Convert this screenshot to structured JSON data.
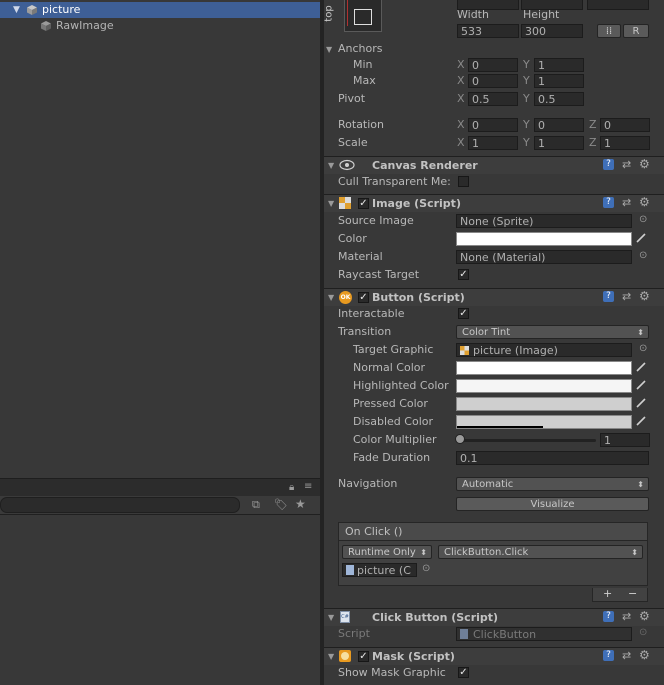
{
  "hierarchy": {
    "items": [
      {
        "label": "picture",
        "selected": true
      },
      {
        "label": "RawImage",
        "selected": false
      }
    ]
  },
  "rect_transform": {
    "anchor_preset_label": "top",
    "width_label": "Width",
    "height_label": "Height",
    "width_value": "533",
    "height_value": "300",
    "r_button": "R",
    "anchors_label": "Anchors",
    "min_label": "Min",
    "max_label": "Max",
    "min_x": "0",
    "min_y": "1",
    "max_x": "0",
    "max_y": "1",
    "pivot_label": "Pivot",
    "pivot_x": "0.5",
    "pivot_y": "0.5",
    "rotation_label": "Rotation",
    "rot_x": "0",
    "rot_y": "0",
    "rot_z": "0",
    "scale_label": "Scale",
    "scale_x": "1",
    "scale_y": "1",
    "scale_z": "1",
    "x": "X",
    "y": "Y",
    "z": "Z"
  },
  "canvas_renderer": {
    "title": "Canvas Renderer",
    "cull_label": "Cull Transparent Me:"
  },
  "image_script": {
    "title": "Image (Script)",
    "source_image_label": "Source Image",
    "source_image_value": "None (Sprite)",
    "color_label": "Color",
    "material_label": "Material",
    "material_value": "None (Material)",
    "raycast_label": "Raycast Target"
  },
  "button_script": {
    "title": "Button (Script)",
    "interactable_label": "Interactable",
    "transition_label": "Transition",
    "transition_value": "Color Tint",
    "target_graphic_label": "Target Graphic",
    "target_graphic_value": "picture (Image)",
    "normal_color_label": "Normal Color",
    "highlighted_color_label": "Highlighted Color",
    "pressed_color_label": "Pressed Color",
    "disabled_color_label": "Disabled Color",
    "color_multiplier_label": "Color Multiplier",
    "color_multiplier_value": "1",
    "fade_duration_label": "Fade Duration",
    "fade_duration_value": "0.1",
    "navigation_label": "Navigation",
    "navigation_value": "Automatic",
    "visualize_button": "Visualize",
    "onclick_label": "On Click ()",
    "runtime_value": "Runtime Only",
    "function_value": "ClickButton.Click",
    "object_value": "picture (C",
    "plus": "+",
    "minus": "−"
  },
  "click_button_script": {
    "title": "Click Button (Script)",
    "script_label": "Script",
    "script_value": "ClickButton"
  },
  "mask_script": {
    "title": "Mask (Script)",
    "show_mask_label": "Show Mask Graphic"
  },
  "icons": {
    "help": "help-icon",
    "preset": "preset-icon",
    "gear": "gear-icon"
  },
  "colors": {
    "selection": "#3e5f96",
    "panel": "#383838",
    "header": "#3d3d3d"
  }
}
